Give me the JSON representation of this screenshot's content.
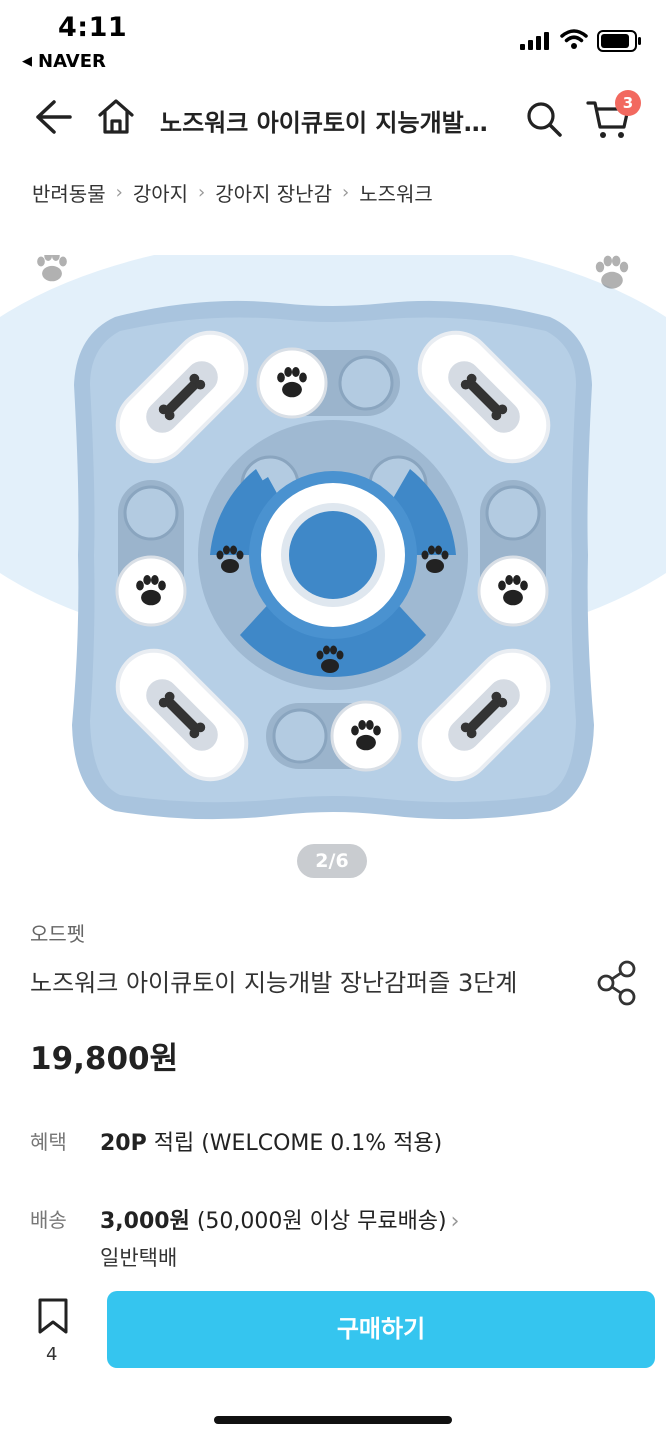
{
  "status_bar": {
    "time": "4:11",
    "back_app": "NAVER"
  },
  "header": {
    "title": "노즈워크 아이큐토이 지능개발…",
    "cart_count": "3"
  },
  "breadcrumb": [
    "반려동물",
    "강아지",
    "강아지 장난감",
    "노즈워크"
  ],
  "gallery": {
    "pager": "2/6"
  },
  "product": {
    "brand": "오드펫",
    "name": "노즈워크 아이큐토이 지능개발 장난감퍼즐 3단계",
    "price": "19,800원"
  },
  "benefit": {
    "label": "혜택",
    "points": "20P",
    "text": " 적립 (WELCOME 0.1% 적용)"
  },
  "shipping": {
    "label": "배송",
    "fee": "3,000원",
    "text": " (50,000원 이상 무료배송)",
    "method": "일반택배"
  },
  "bottom": {
    "bookmark_count": "4",
    "buy_label": "구매하기"
  },
  "colors": {
    "accent": "#35c5ef",
    "badge": "#f2695f",
    "puzzle_base": "#a9c4de",
    "puzzle_center": "#3f88c8"
  },
  "icons": [
    "back-arrow-icon",
    "home-icon",
    "search-icon",
    "cart-icon",
    "share-icon",
    "bookmark-icon",
    "paw-icon",
    "bone-icon"
  ]
}
